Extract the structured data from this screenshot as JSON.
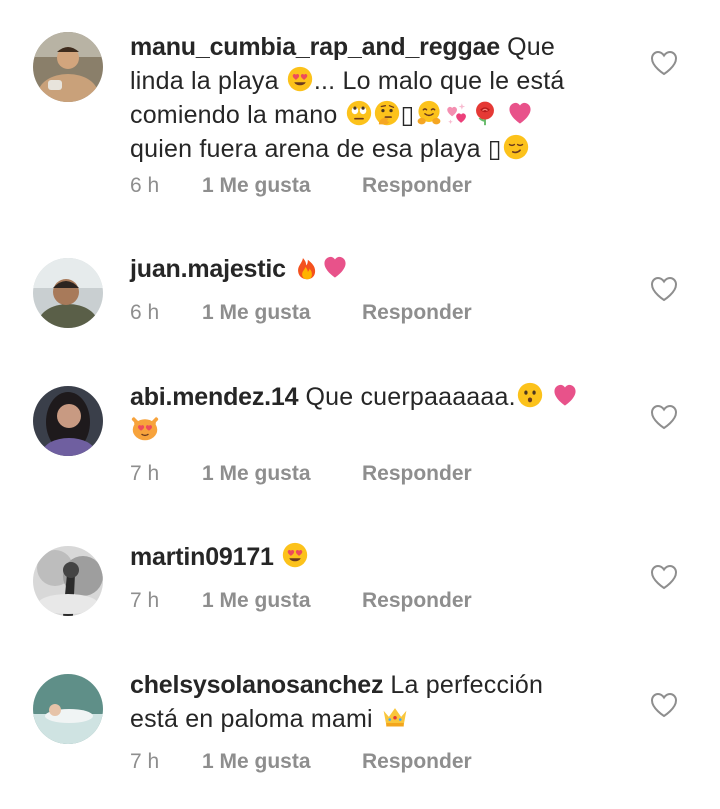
{
  "comments": [
    {
      "username": "manu_cumbia_rap_and_reggae",
      "text_line1": " Que",
      "text_line2a": "linda la playa ",
      "text_line2b": "... Lo malo que le está",
      "text_line3": "comiendo la mano ",
      "text_line4": "quien fuera arena de esa playa ",
      "missing_glyph": "▯",
      "time": "6 h",
      "likes": "1 Me gusta",
      "reply": "Responder"
    },
    {
      "username": "juan.majestic",
      "time": "6 h",
      "likes": "1 Me gusta",
      "reply": "Responder"
    },
    {
      "username": "abi.mendez.14",
      "text": " Que cuerpaaaaaa.",
      "time": "7 h",
      "likes": "1 Me gusta",
      "reply": "Responder"
    },
    {
      "username": "martin09171",
      "time": "7 h",
      "likes": "1 Me gusta",
      "reply": "Responder"
    },
    {
      "username": "chelsysolanosanchez",
      "text_line1": " La perfección",
      "text_line2": "está en paloma mami ",
      "time": "7 h",
      "likes": "1 Me gusta",
      "reply": "Responder"
    }
  ],
  "icons": {
    "heart_emoji_color": "#e8528a",
    "like_icon": "heart-outline-icon",
    "meta_color": "#8e8e8e"
  }
}
